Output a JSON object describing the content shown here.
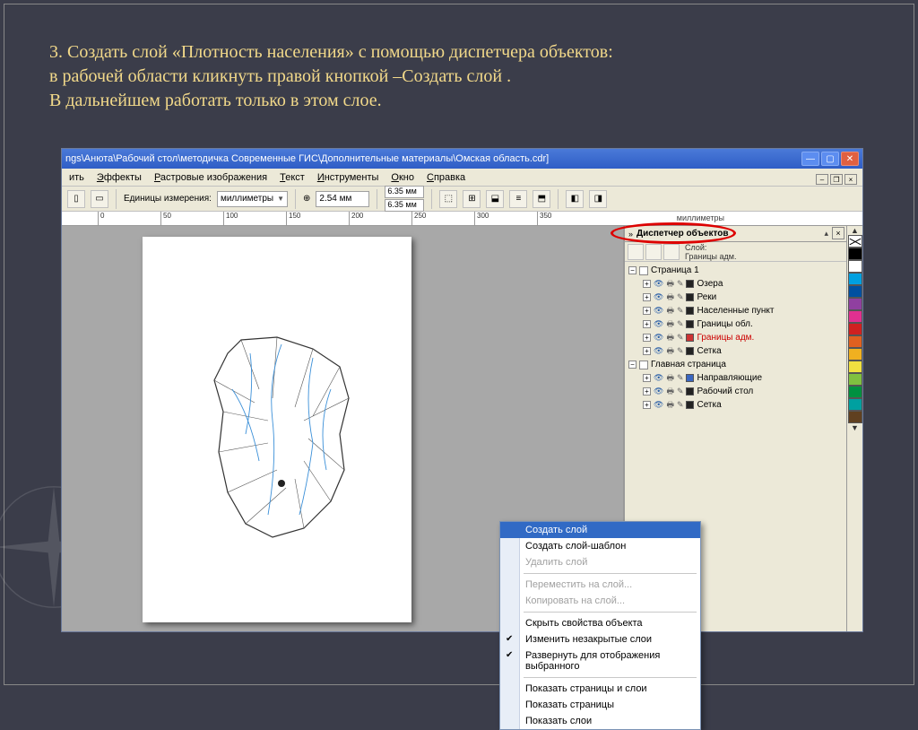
{
  "instruction": {
    "line1": "3. Создать слой «Плотность населения» с помощью диспетчера объектов:",
    "line2": "в рабочей области кликнуть правой кнопкой –Создать слой .",
    "line3": "В дальнейшем работать только в этом слое."
  },
  "titlebar": "ngs\\Анюта\\Рабочий стол\\методичка Современные ГИС\\Дополнительные материалы\\Омская область.cdr]",
  "menu": {
    "m0": "ить",
    "m1": "Эффекты",
    "m2": "Растровые изображения",
    "m3": "Текст",
    "m4": "Инструменты",
    "m5": "Окно",
    "m6": "Справка"
  },
  "propbar": {
    "units_label": "Единицы измерения:",
    "units_value": "миллиметры",
    "nudge": "2.54 мм",
    "dupX": "6.35 мм",
    "dupY": "6.35 мм"
  },
  "ruler": {
    "t0": "0",
    "t50": "50",
    "t100": "100",
    "t150": "150",
    "t200": "200",
    "t250": "250",
    "t300": "300",
    "t350": "350",
    "units": "миллиметры"
  },
  "docker": {
    "title": "Диспетчер объектов",
    "info_label": "Слой:",
    "info_value": "Границы адм.",
    "page1": "Страница 1",
    "layers_p1": [
      {
        "name": "Озера",
        "color": "#222"
      },
      {
        "name": "Реки",
        "color": "#222"
      },
      {
        "name": "Населенные пункт",
        "color": "#222"
      },
      {
        "name": "Границы обл.",
        "color": "#222"
      },
      {
        "name": "Границы адм.",
        "color": "#c33",
        "selected": true
      },
      {
        "name": "Сетка",
        "color": "#222"
      }
    ],
    "master": "Главная страница",
    "layers_master": [
      {
        "name": "Направляющие",
        "color": "#3a66c0"
      },
      {
        "name": "Рабочий стол",
        "color": "#222"
      },
      {
        "name": "Сетка",
        "color": "#222"
      }
    ]
  },
  "contextmenu": {
    "items": [
      {
        "label": "Создать слой",
        "selected": true
      },
      {
        "label": "Создать слой-шаблон"
      },
      {
        "label": "Удалить слой",
        "disabled": true
      },
      {
        "sep": true
      },
      {
        "label": "Переместить на слой...",
        "disabled": true
      },
      {
        "label": "Копировать на слой...",
        "disabled": true
      },
      {
        "sep": true
      },
      {
        "label": "Скрыть свойства объекта"
      },
      {
        "label": "Изменить незакрытые слои",
        "checked": true
      },
      {
        "label": "Развернуть для отображения выбранного",
        "checked": true
      },
      {
        "sep": true
      },
      {
        "label": "Показать страницы и слои"
      },
      {
        "label": "Показать страницы"
      },
      {
        "label": "Показать слои"
      }
    ]
  },
  "palette": [
    "#000000",
    "#ffffff",
    "#00a0e0",
    "#0050a0",
    "#9040a0",
    "#e03090",
    "#d02020",
    "#e06020",
    "#f0b020",
    "#f0e040",
    "#80c040",
    "#009040",
    "#00a0a0",
    "#604020"
  ]
}
